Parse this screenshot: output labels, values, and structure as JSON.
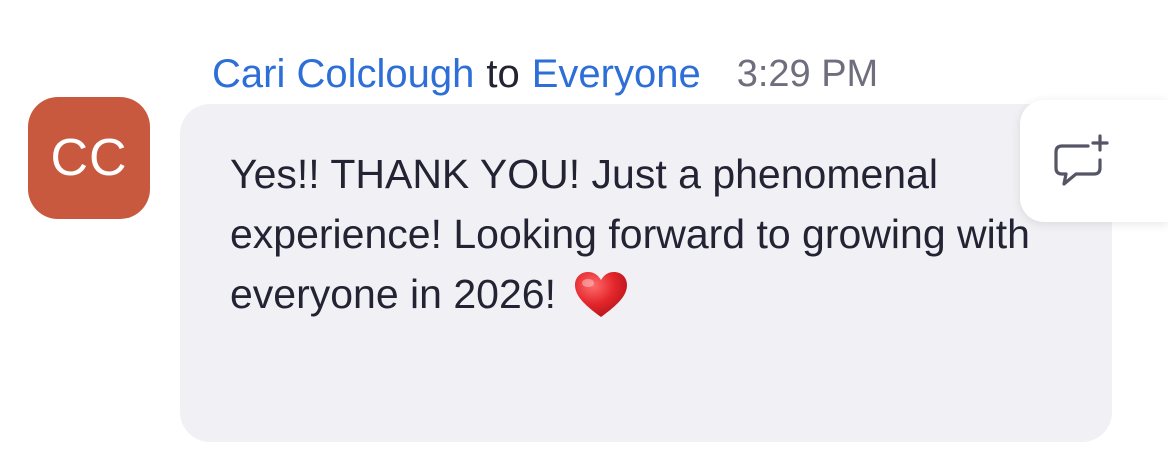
{
  "message": {
    "sender": "Cari Colclough",
    "to_word": "to",
    "recipient": "Everyone",
    "time": "3:29 PM",
    "avatar_initials": "CC",
    "text": "Yes!! THANK YOU! Just a phenomenal experience! Looking forward to growing with everyone in 2026!",
    "trailing_emoji": "red-heart-emoji"
  },
  "actions": {
    "reply_icon": "comment-add-icon"
  },
  "colors": {
    "sender_link": "#2D6FD7",
    "avatar_bg": "#C9593E",
    "bubble_bg": "#F1F1F5",
    "timestamp": "#6E6E7E",
    "heart": "#E3262B"
  }
}
